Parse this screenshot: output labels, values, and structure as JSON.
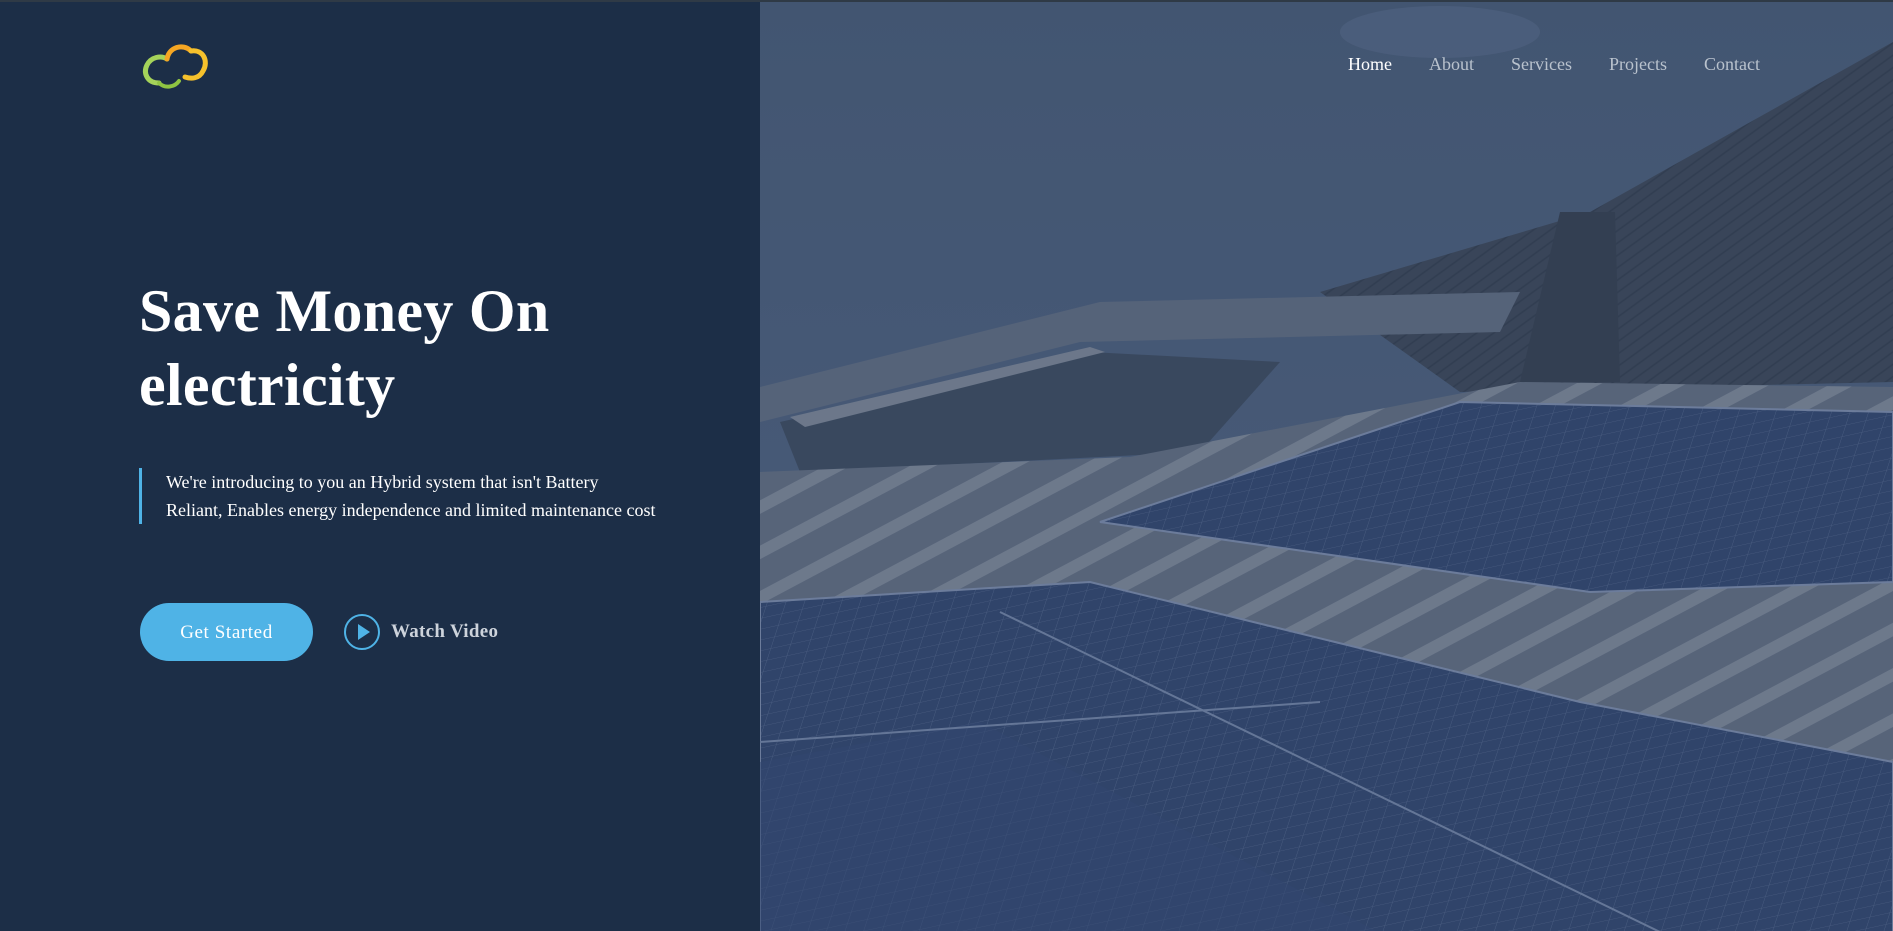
{
  "nav": {
    "items": [
      {
        "label": "Home",
        "active": true
      },
      {
        "label": "About",
        "active": false
      },
      {
        "label": "Services",
        "active": false
      },
      {
        "label": "Projects",
        "active": false
      },
      {
        "label": "Contact",
        "active": false
      }
    ]
  },
  "hero": {
    "title_line1": "Save Money On",
    "title_line2": "electricity",
    "description": "We're introducing to you an Hybrid system that isn't Battery Reliant, Enables energy independence and limited maintenance cost",
    "cta_label": "Get Started",
    "video_label": "Watch Video"
  },
  "logo": {
    "icon": "cloud-icon",
    "colors": [
      "#a5d35a",
      "#f5a623",
      "#f6c12c"
    ]
  },
  "colors": {
    "background": "#1c2e47",
    "accent": "#4fb3e6",
    "image_overlay": "#4a5d78"
  }
}
